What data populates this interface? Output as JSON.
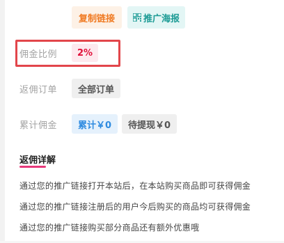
{
  "actions": {
    "copy_link_label": "复制链接",
    "poster_label": "推广海报"
  },
  "commission_rate": {
    "label": "佣金比例",
    "value": "2%"
  },
  "commission_orders": {
    "label": "返佣订单",
    "button_label": "全部订单"
  },
  "accumulated": {
    "label": "累计佣金",
    "total_label": "累计￥0",
    "pending_label": "待提现￥0"
  },
  "details": {
    "title": "返佣详解",
    "lines": [
      "通过您的推广链接打开本站后，在本站购买商品即可获得佣金",
      "通过您的推广链接注册后的用户今后购买的商品均可获得佣金",
      "通过您的推广链接购买部分商品还有额外优惠哦"
    ]
  },
  "colors": {
    "highlight": "#e2464b",
    "accent_pink": "#e8397b",
    "orange": "#f07a22",
    "teal": "#1c9b95",
    "blue": "#2e8be0"
  },
  "icons": {
    "poster": "qrcode-icon"
  }
}
